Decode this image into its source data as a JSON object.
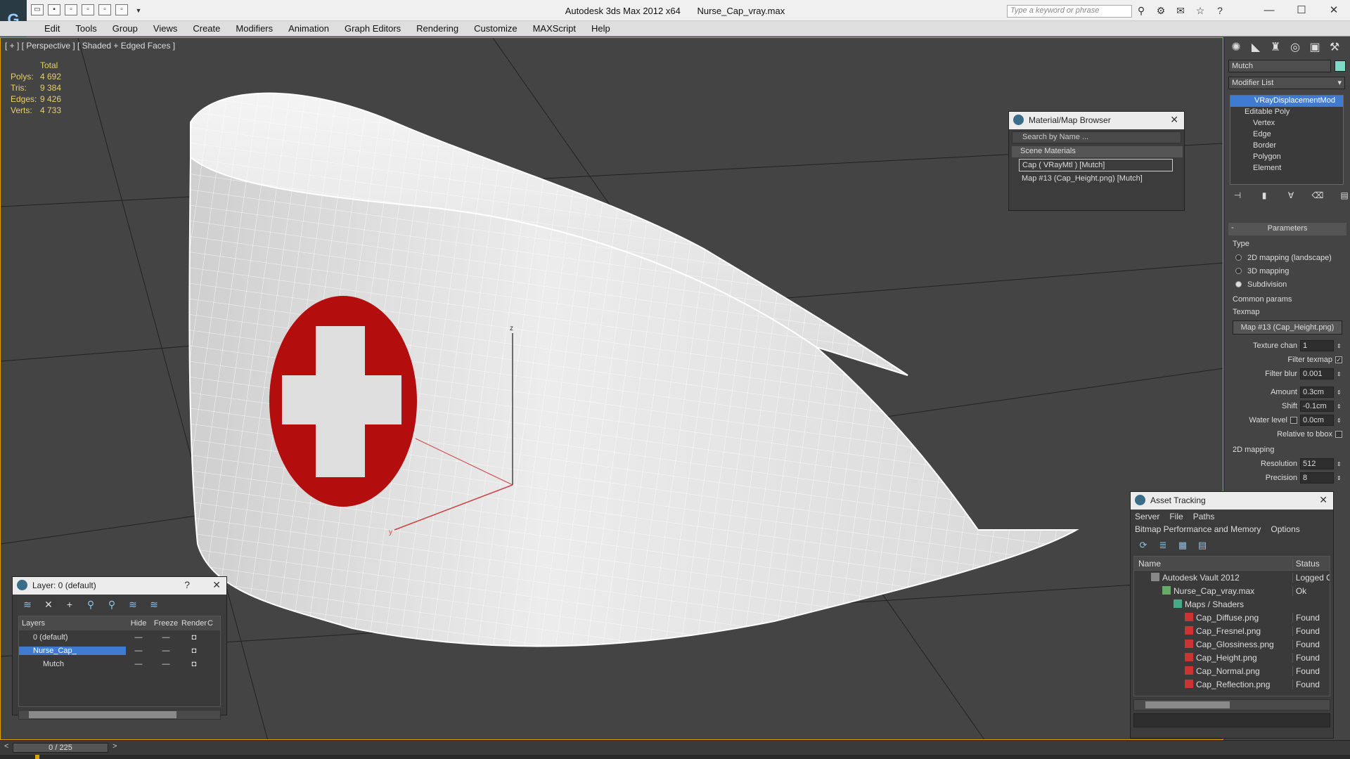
{
  "titlebar": {
    "app": "Autodesk 3ds Max  2012 x64",
    "file": "Nurse_Cap_vray.max",
    "search_placeholder": "Type a keyword or phrase",
    "minimize": "—",
    "maximize": "☐",
    "close": "✕"
  },
  "menu": [
    "Edit",
    "Tools",
    "Group",
    "Views",
    "Create",
    "Modifiers",
    "Animation",
    "Graph Editors",
    "Rendering",
    "Customize",
    "MAXScript",
    "Help"
  ],
  "viewport": {
    "label": "[ + ] [ Perspective ] [ Shaded + Edged Faces ]",
    "stats": {
      "header": "Total",
      "rows": [
        {
          "k": "Polys:",
          "v": "4 692"
        },
        {
          "k": "Tris:",
          "v": "9 384"
        },
        {
          "k": "Edges:",
          "v": "9 426"
        },
        {
          "k": "Verts:",
          "v": "4 733"
        }
      ]
    },
    "axis_z": "z",
    "axis_y": "y"
  },
  "material_browser": {
    "title": "Material/Map Browser",
    "search": "Search by Name ...",
    "section": "Scene Materials",
    "items": [
      "Cap  ( VRayMtl )  [Mutch]",
      "Map #13 (Cap_Height.png)  [Mutch]"
    ]
  },
  "command_panel": {
    "object_name": "Mutch",
    "object_color": "#7ed9c8",
    "modifier_list": "Modifier List",
    "stack": [
      "VRayDisplacementMod",
      "Editable Poly",
      "Vertex",
      "Edge",
      "Border",
      "Polygon",
      "Element"
    ],
    "params": {
      "title": "Parameters",
      "type_label": "Type",
      "types": [
        "2D mapping (landscape)",
        "3D mapping",
        "Subdivision"
      ],
      "selected_type": 2,
      "common_label": "Common params",
      "texmap_label": "Texmap",
      "texmap_value": "Map #13 (Cap_Height.png)",
      "texture_chan_label": "Texture chan",
      "texture_chan": "1",
      "filter_texmap_label": "Filter texmap",
      "filter_blur_label": "Filter blur",
      "filter_blur": "0.001",
      "amount_label": "Amount",
      "amount": "0.3cm",
      "shift_label": "Shift",
      "shift": "-0.1cm",
      "water_label": "Water level",
      "water": "0.0cm",
      "relbbox_label": "Relative to bbox",
      "mapping2d_label": "2D mapping",
      "resolution_label": "Resolution",
      "resolution": "512",
      "precision_label": "Precision",
      "precision": "8"
    }
  },
  "layer_panel": {
    "title": "Layer: 0 (default)",
    "help": "?",
    "close": "✕",
    "columns": [
      "Layers",
      "Hide",
      "Freeze",
      "Render",
      "C"
    ],
    "rows": [
      {
        "name": "0 (default)"
      },
      {
        "name": "Nurse_Cap_"
      },
      {
        "name": "Mutch"
      }
    ]
  },
  "asset_panel": {
    "title": "Asset Tracking",
    "menu": [
      "Server",
      "File",
      "Paths"
    ],
    "menu2": [
      "Bitmap Performance and Memory",
      "Options"
    ],
    "columns": [
      "Name",
      "Status"
    ],
    "rows": [
      {
        "name": "Autodesk Vault 2012",
        "status": "Logged O"
      },
      {
        "name": "Nurse_Cap_vray.max",
        "status": "Ok"
      },
      {
        "name": "Maps / Shaders",
        "status": ""
      },
      {
        "name": "Cap_Diffuse.png",
        "status": "Found"
      },
      {
        "name": "Cap_Fresnel.png",
        "status": "Found"
      },
      {
        "name": "Cap_Glossiness.png",
        "status": "Found"
      },
      {
        "name": "Cap_Height.png",
        "status": "Found"
      },
      {
        "name": "Cap_Normal.png",
        "status": "Found"
      },
      {
        "name": "Cap_Reflection.png",
        "status": "Found"
      }
    ]
  },
  "timeline": {
    "frame": "0 / 225"
  }
}
